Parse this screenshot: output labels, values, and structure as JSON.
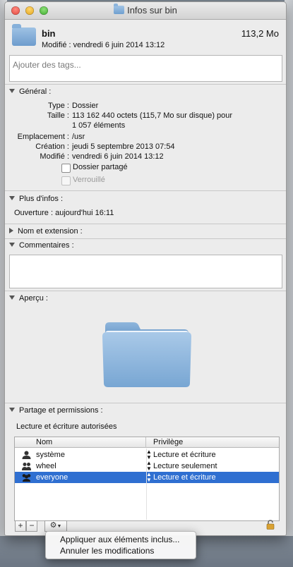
{
  "window": {
    "title": "Infos sur bin"
  },
  "header": {
    "name": "bin",
    "modified_line": "Modifié : vendredi 6 juin 2014 13:12",
    "size": "113,2 Mo"
  },
  "tags": {
    "placeholder": "Ajouter des tags..."
  },
  "general": {
    "title": "Général :",
    "rows": [
      {
        "label": "Type :",
        "value": "Dossier"
      },
      {
        "label": "Taille :",
        "value": "113 162 440 octets (115,7 Mo sur disque) pour"
      },
      {
        "label": "",
        "value": "1 057 éléments"
      },
      {
        "label": "Emplacement :",
        "value": "/usr"
      },
      {
        "label": "Création :",
        "value": "jeudi 5 septembre 2013 07:54"
      },
      {
        "label": "Modifié :",
        "value": "vendredi 6 juin 2014 13:12"
      }
    ],
    "shared_folder": "Dossier partagé",
    "locked": "Verrouillé"
  },
  "more_info": {
    "title": "Plus d'infos :",
    "opened": "Ouverture : aujourd'hui 16:11"
  },
  "name_ext": {
    "title": "Nom et extension :"
  },
  "comments": {
    "title": "Commentaires :"
  },
  "preview": {
    "title": "Aperçu :"
  },
  "sharing": {
    "title": "Partage et permissions :",
    "status": "Lecture et écriture autorisées",
    "columns": {
      "name": "Nom",
      "privilege": "Privilège"
    },
    "rows": [
      {
        "name": "système",
        "privilege": "Lecture et écriture",
        "icon": "single-user-icon",
        "selected": false
      },
      {
        "name": "wheel",
        "privilege": "Lecture seulement",
        "icon": "group-icon",
        "selected": false
      },
      {
        "name": "everyone",
        "privilege": "Lecture et écriture",
        "icon": "everyone-icon",
        "selected": true
      }
    ],
    "add": "+",
    "remove": "−"
  },
  "action_menu": {
    "items": [
      "Appliquer aux éléments inclus...",
      "Annuler les modifications"
    ]
  },
  "colors": {
    "selection": "#2f6fd1",
    "folder": "#7fa8d6"
  }
}
